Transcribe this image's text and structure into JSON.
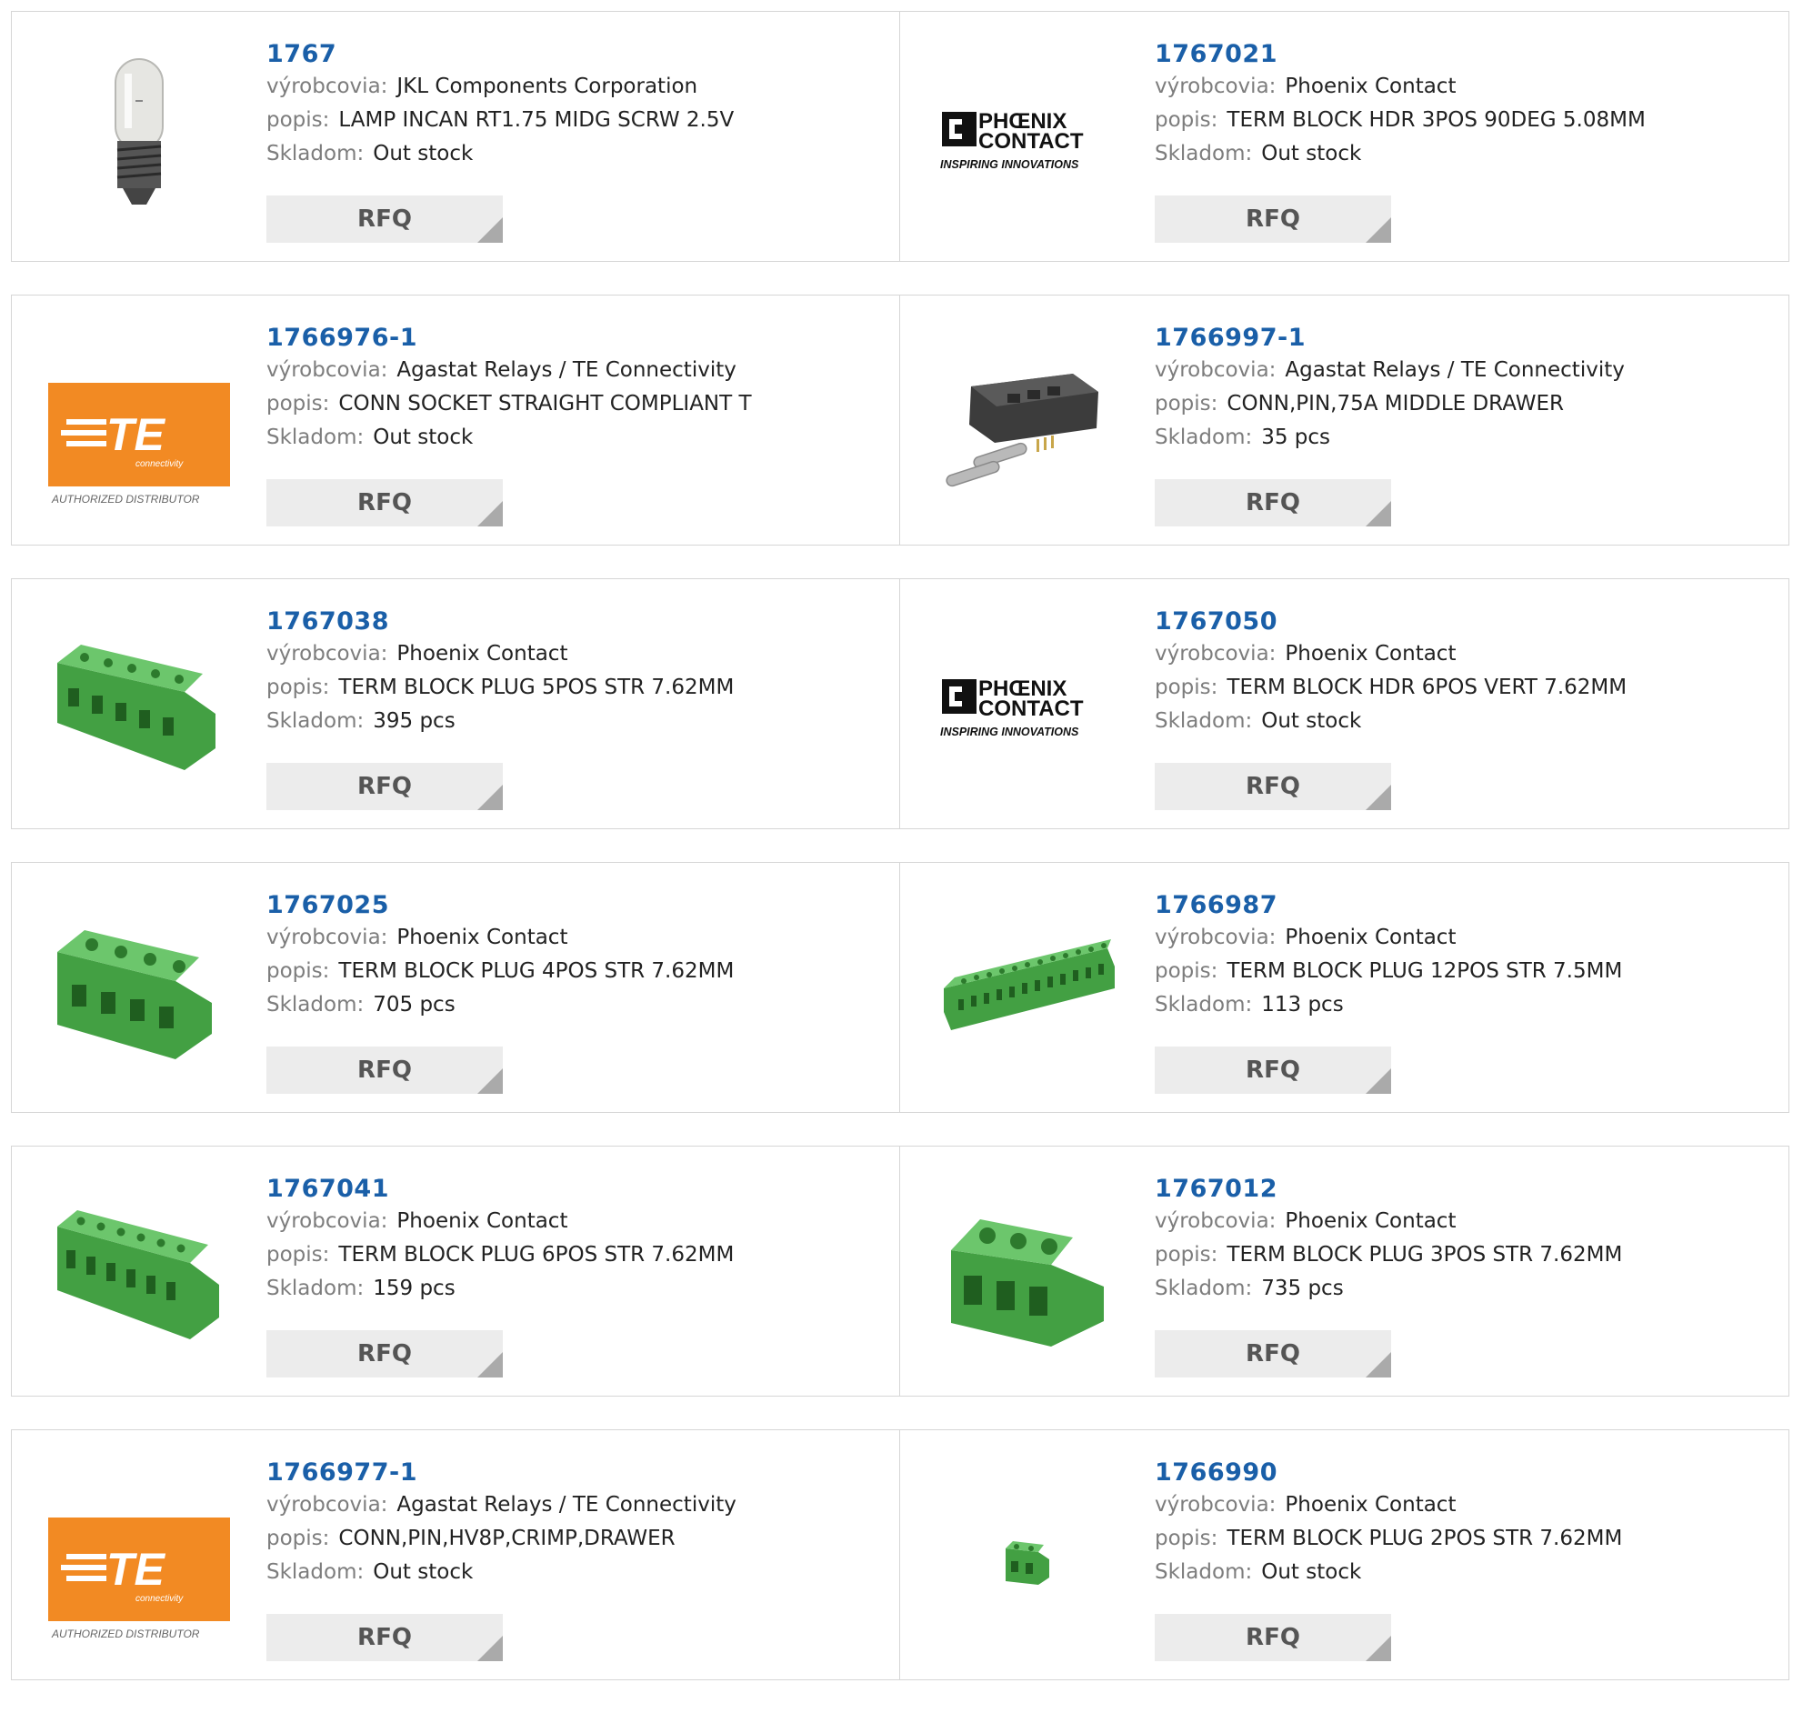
{
  "labels": {
    "manufacturer": "výrobcovia:",
    "description": "popis:",
    "stock": "Skladom:",
    "rfq": "RFQ"
  },
  "logos": {
    "phoenix_line1": "PHŒNIX",
    "phoenix_line2": "CONTACT",
    "phoenix_tagline": "INSPIRING INNOVATIONS",
    "te_mark": "TE",
    "te_sub": "connectivity",
    "te_tagline": "AUTHORIZED DISTRIBUTOR"
  },
  "colors": {
    "part_link": "#1a5fa8",
    "te_orange": "#f28a23",
    "terminal_green": "#4fb04f"
  },
  "products": [
    {
      "part": "1767",
      "manufacturer": "JKL Components Corporation",
      "description": "LAMP INCAN RT1.75 MIDG SCRW 2.5V",
      "stock": "Out stock",
      "image": "lamp-bulb"
    },
    {
      "part": "1767021",
      "manufacturer": "Phoenix Contact",
      "description": "TERM BLOCK HDR 3POS 90DEG 5.08MM",
      "stock": "Out stock",
      "image": "phoenix-logo"
    },
    {
      "part": "1766976-1",
      "manufacturer": "Agastat Relays / TE Connectivity",
      "description": "CONN SOCKET STRAIGHT COMPLIANT T",
      "stock": "Out stock",
      "image": "te-logo"
    },
    {
      "part": "1766997-1",
      "manufacturer": "Agastat Relays / TE Connectivity",
      "description": "CONN,PIN,75A MIDDLE DRAWER",
      "stock": "35 pcs",
      "image": "drawer-connector"
    },
    {
      "part": "1767038",
      "manufacturer": "Phoenix Contact",
      "description": "TERM BLOCK PLUG 5POS STR 7.62MM",
      "stock": "395 pcs",
      "image": "terminal-5pos"
    },
    {
      "part": "1767050",
      "manufacturer": "Phoenix Contact",
      "description": "TERM BLOCK HDR 6POS VERT 7.62MM",
      "stock": "Out stock",
      "image": "phoenix-logo"
    },
    {
      "part": "1767025",
      "manufacturer": "Phoenix Contact",
      "description": "TERM BLOCK PLUG 4POS STR 7.62MM",
      "stock": "705 pcs",
      "image": "terminal-4pos"
    },
    {
      "part": "1766987",
      "manufacturer": "Phoenix Contact",
      "description": "TERM BLOCK PLUG 12POS STR 7.5MM",
      "stock": "113 pcs",
      "image": "terminal-12pos"
    },
    {
      "part": "1767041",
      "manufacturer": "Phoenix Contact",
      "description": "TERM BLOCK PLUG 6POS STR 7.62MM",
      "stock": "159 pcs",
      "image": "terminal-6pos"
    },
    {
      "part": "1767012",
      "manufacturer": "Phoenix Contact",
      "description": "TERM BLOCK PLUG 3POS STR 7.62MM",
      "stock": "735 pcs",
      "image": "terminal-3pos"
    },
    {
      "part": "1766977-1",
      "manufacturer": "Agastat Relays / TE Connectivity",
      "description": "CONN,PIN,HV8P,CRIMP,DRAWER",
      "stock": "Out stock",
      "image": "te-logo"
    },
    {
      "part": "1766990",
      "manufacturer": "Phoenix Contact",
      "description": "TERM BLOCK PLUG 2POS STR 7.62MM",
      "stock": "Out stock",
      "image": "terminal-2pos"
    }
  ]
}
